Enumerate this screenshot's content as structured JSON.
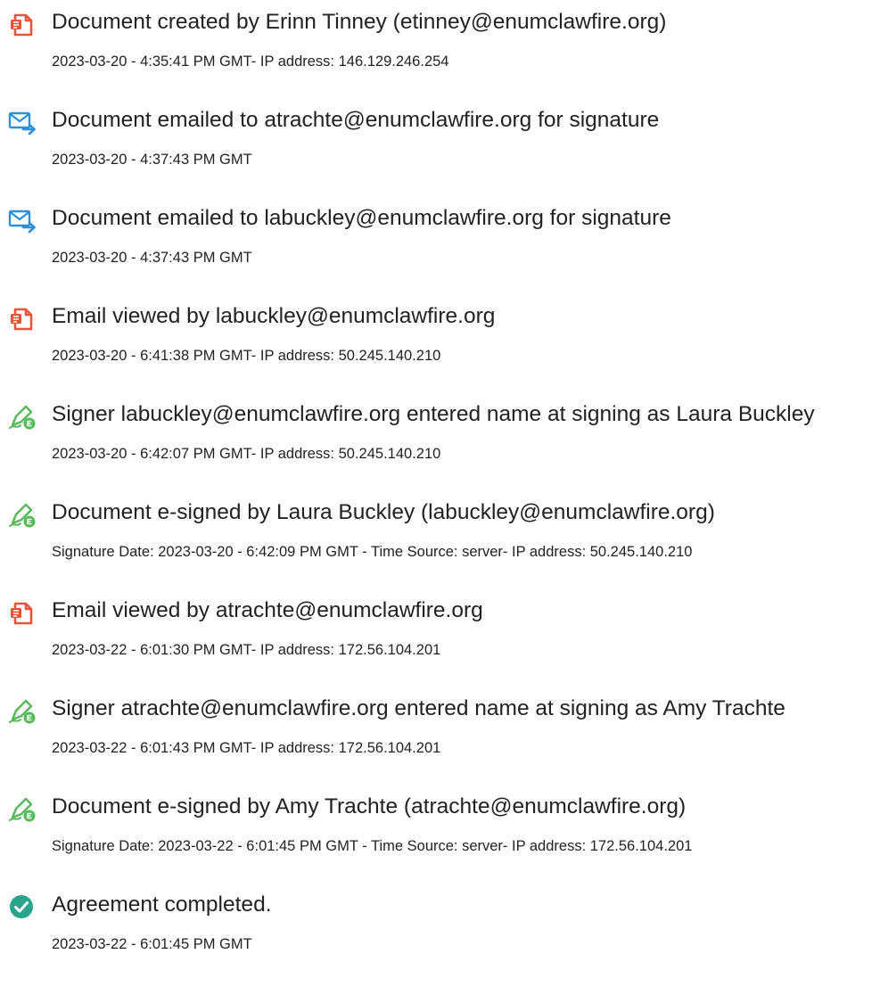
{
  "colors": {
    "document_icon": "#e8543b",
    "email_icon": "#2d8fd6",
    "signature_icon": "#58b85a",
    "check_icon": "#2aa58d",
    "text": "#222222"
  },
  "events": [
    {
      "icon": "document-icon",
      "title": "Document created by Erinn Tinney (etinney@enumclawfire.org)",
      "detail": "2023-03-20 - 4:35:41 PM GMT- IP address: 146.129.246.254"
    },
    {
      "icon": "email-sent-icon",
      "title": "Document emailed to atrachte@enumclawfire.org for signature",
      "detail": "2023-03-20 - 4:37:43 PM GMT"
    },
    {
      "icon": "email-sent-icon",
      "title": "Document emailed to labuckley@enumclawfire.org for signature",
      "detail": "2023-03-20 - 4:37:43 PM GMT"
    },
    {
      "icon": "document-icon",
      "title": "Email viewed by labuckley@enumclawfire.org",
      "detail": "2023-03-20 - 6:41:38 PM GMT- IP address: 50.245.140.210"
    },
    {
      "icon": "signature-pen-icon",
      "title": "Signer labuckley@enumclawfire.org entered name at signing as Laura Buckley",
      "detail": "2023-03-20 - 6:42:07 PM GMT- IP address: 50.245.140.210"
    },
    {
      "icon": "signature-pen-icon",
      "title": "Document e-signed by Laura Buckley (labuckley@enumclawfire.org)",
      "detail": "Signature Date: 2023-03-20 - 6:42:09 PM GMT - Time Source: server- IP address: 50.245.140.210"
    },
    {
      "icon": "document-icon",
      "title": "Email viewed by atrachte@enumclawfire.org",
      "detail": "2023-03-22 - 6:01:30 PM GMT- IP address: 172.56.104.201"
    },
    {
      "icon": "signature-pen-icon",
      "title": "Signer atrachte@enumclawfire.org entered name at signing as Amy Trachte",
      "detail": "2023-03-22 - 6:01:43 PM GMT- IP address: 172.56.104.201"
    },
    {
      "icon": "signature-pen-icon",
      "title": "Document e-signed by Amy Trachte (atrachte@enumclawfire.org)",
      "detail": "Signature Date: 2023-03-22 - 6:01:45 PM GMT - Time Source: server- IP address: 172.56.104.201"
    },
    {
      "icon": "checkmark-circle-icon",
      "title": "Agreement completed.",
      "detail": "2023-03-22 - 6:01:45 PM GMT"
    }
  ]
}
